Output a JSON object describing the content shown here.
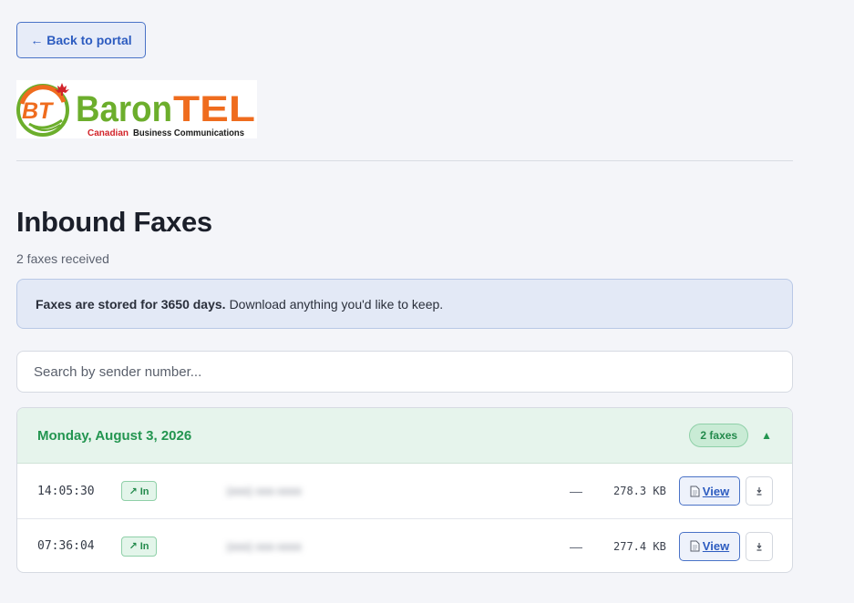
{
  "nav": {
    "back_label": "← Back to portal"
  },
  "brand": {
    "logo_initials": "BT",
    "logo_name_part1": "Baron",
    "logo_name_part2": "TEL",
    "logo_tagline_part1": "Canadian",
    "logo_tagline_part2": "Business Communications",
    "colors": {
      "orange": "#ef6c1e",
      "green": "#6cae2c",
      "red": "#d2232a"
    }
  },
  "page": {
    "title": "Inbound Faxes",
    "subtitle": "2 faxes received"
  },
  "notice": {
    "bold_text": "Faxes are stored for 3650 days.",
    "text": "Download anything you'd like to keep."
  },
  "search": {
    "placeholder": "Search by sender number..."
  },
  "day_group": {
    "date_label": "Monday, August 3, 2026",
    "count_label": "2 faxes",
    "collapse_icon": "triangle-up-icon",
    "rows": [
      {
        "time": "14:05:30",
        "direction": "↗ In",
        "sender": "(xxx) xxx-xxxx",
        "pages": "—",
        "size": "278.3 KB",
        "view_label": "View",
        "download_icon": "download-icon"
      },
      {
        "time": "07:36:04",
        "direction": "↗ In",
        "sender": "(xxx) xxx-xxxx",
        "pages": "—",
        "size": "277.4 KB",
        "view_label": "View",
        "download_icon": "download-icon"
      }
    ]
  },
  "colors": {
    "accent_blue": "#2d5cc0",
    "success_green": "#239550",
    "background": "#f4f5f9"
  }
}
